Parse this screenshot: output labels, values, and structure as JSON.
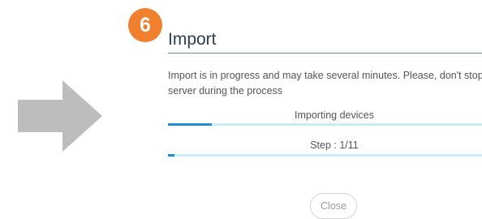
{
  "step_badge": "6",
  "dialog": {
    "title": "Import",
    "message": "Import is in progress and may take several minutes. Please, don't stop server during the process",
    "progress_1": {
      "label": "Importing devices",
      "fraction": 0.14
    },
    "progress_2": {
      "label": "Step : 1/11",
      "fraction": 0.02
    },
    "close_label": "Close"
  },
  "colors": {
    "badge": "#f07f2e",
    "arrow": "#bdbdbd",
    "progress_fill": "#1a8fd2",
    "progress_track": "#c9ecf8",
    "title_text": "#2c3e50"
  },
  "icons": {
    "arrow": "arrow-right-icon"
  }
}
